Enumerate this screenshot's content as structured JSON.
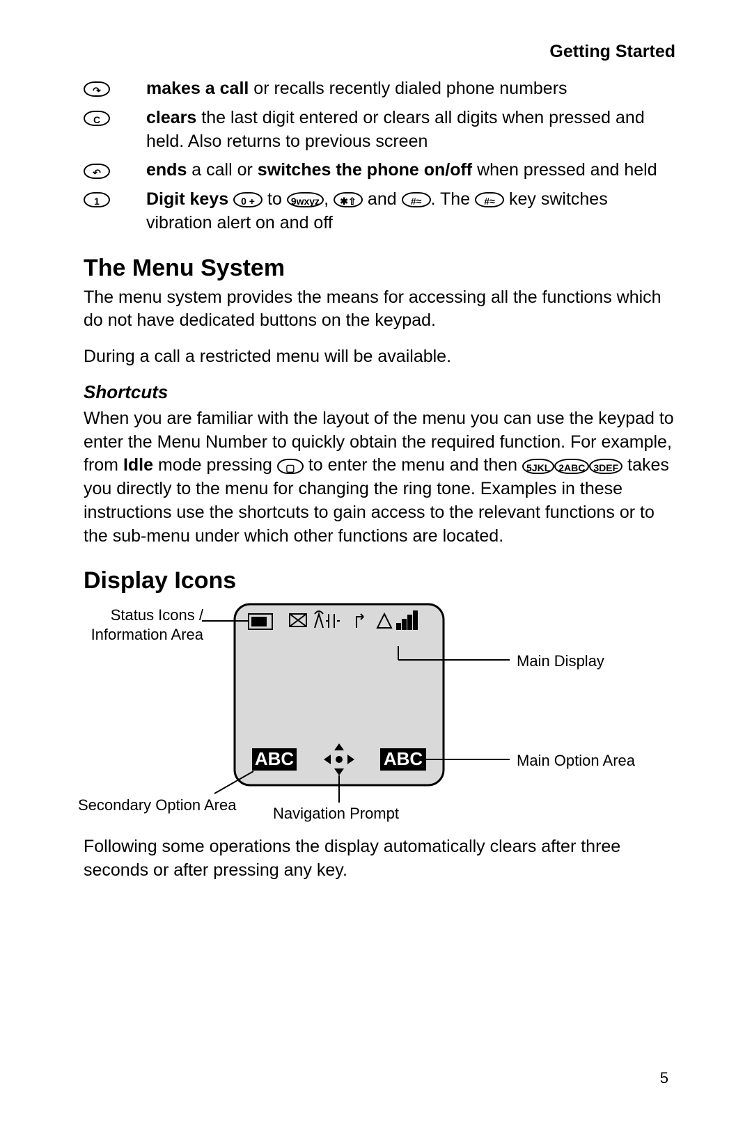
{
  "header": "Getting Started",
  "defs": [
    {
      "icon_glyph": "↷",
      "bold": "makes a call",
      "rest": " or recalls recently dialed phone numbers"
    },
    {
      "icon_glyph": "C",
      "bold": "clears",
      "rest": " the last digit entered or clears all digits when pressed and held. Also returns to previous screen"
    },
    {
      "icon_glyph": "↶",
      "bold": "ends",
      "rest_a": " a call or ",
      "bold_b": "switches the phone on/off",
      "rest_b": " when pressed and held"
    },
    {
      "icon_glyph": "1",
      "bold": "Digit keys ",
      "k0": "0 +",
      "mid_to": " to ",
      "k9": "9wxyz",
      "mid_comma": ", ",
      "kstar": "✱⇧",
      "mid_and": " and ",
      "khash": "#≈",
      "rest_a": ". The ",
      "khash2": "#≈",
      "rest_b": " key switches vibration alert on and off"
    }
  ],
  "menu_system": {
    "title": "The Menu System",
    "p1": "The menu system provides the means for accessing all the functions which do not have dedicated buttons on the keypad.",
    "p2": "During a call a restricted menu will be available."
  },
  "shortcuts": {
    "title": "Shortcuts",
    "p_a": "When you are familiar with the layout of the menu you can use the keypad to enter the Menu Number to quickly obtain the required function. For example, from ",
    "idle": "Idle",
    "p_b": " mode pressing ",
    "kmenu": "▢",
    "p_c": " to enter the menu and then ",
    "k5": "5JKL",
    "k2": "2ABC",
    "k3": "3DEF",
    "p_d": " takes you directly to the menu for changing the ring tone. Examples in these instructions use the shortcuts to gain access to the relevant functions or to the sub-menu under which other functions are located."
  },
  "display_icons": {
    "title": "Display Icons",
    "labels": {
      "status_icons": "Status Icons / Information Area",
      "main_display": "Main Display",
      "main_option": "Main Option Area",
      "secondary_option": "Secondary Option Area",
      "nav_prompt": "Navigation Prompt"
    },
    "screen": {
      "abc_left": "ABC",
      "abc_right": "ABC"
    }
  },
  "closing_p": "Following some operations the display automatically clears after three seconds or after pressing any key.",
  "page_number": "5"
}
